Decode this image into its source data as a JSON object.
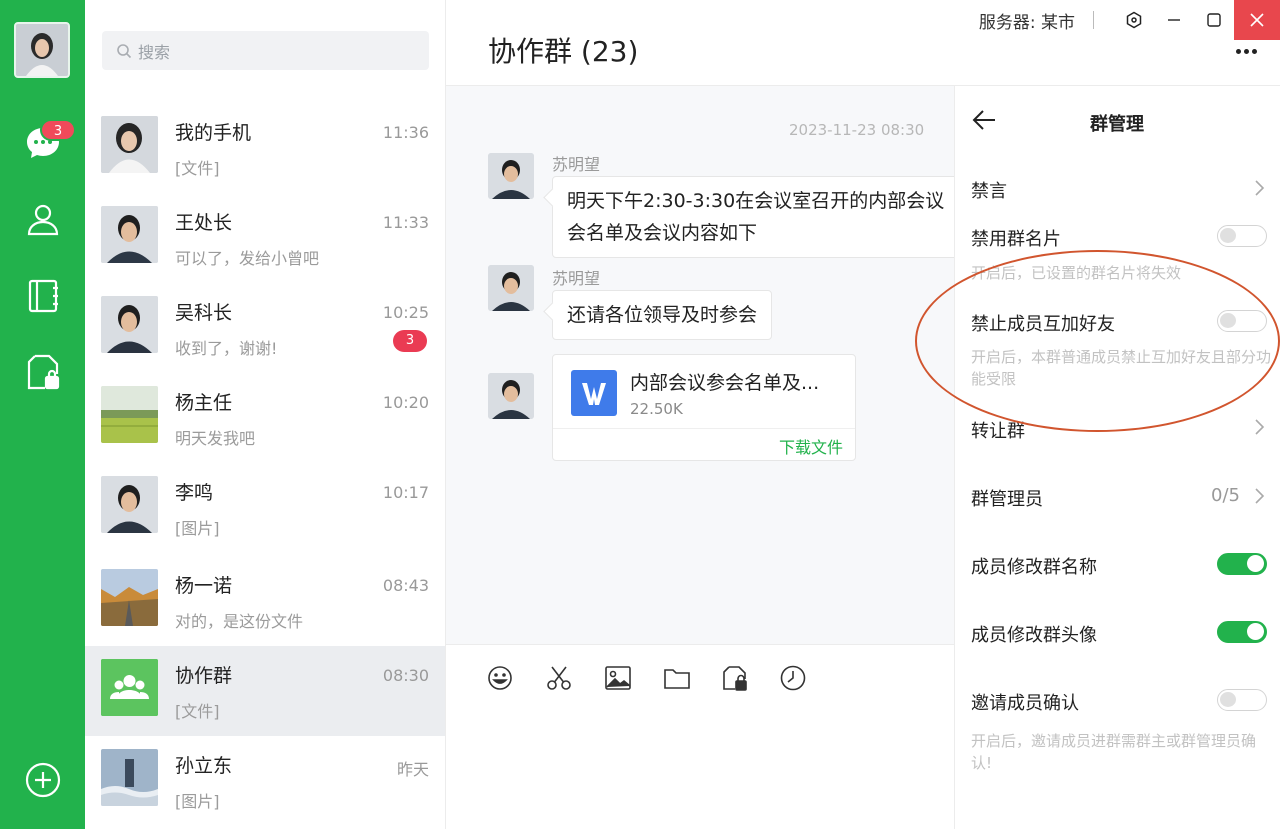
{
  "sidebar": {
    "unread_badge": "3",
    "icons": [
      "chat-icon",
      "contacts-icon",
      "notebook-icon",
      "secure-file-icon",
      "add-icon"
    ]
  },
  "search": {
    "placeholder": "搜索"
  },
  "contacts": [
    {
      "name": "我的手机",
      "time": "11:36",
      "preview": "[文件]",
      "badge": ""
    },
    {
      "name": "王处长",
      "time": "11:33",
      "preview": "可以了，发给小曾吧",
      "badge": ""
    },
    {
      "name": "吴科长",
      "time": "10:25",
      "preview": "收到了，谢谢!",
      "badge": "3"
    },
    {
      "name": "杨主任",
      "time": "10:20",
      "preview": "明天发我吧",
      "badge": ""
    },
    {
      "name": "李鸣",
      "time": "10:17",
      "preview": "[图片]",
      "badge": ""
    },
    {
      "name": "杨一诺",
      "time": "08:43",
      "preview": "对的，是这份文件",
      "badge": ""
    },
    {
      "name": "协作群",
      "time": "08:30",
      "preview": "[文件]",
      "badge": "",
      "active": true
    },
    {
      "name": "孙立东",
      "time": "昨天",
      "preview": "[图片]",
      "badge": ""
    }
  ],
  "chat": {
    "title": "协作群 (23)",
    "timestamp": "2023-11-23  08:30",
    "messages": [
      {
        "sender": "苏明望",
        "text_line1": "明天下午2:30-3:30在会议室召开的内部会议",
        "text_line2": "会名单及会议内容如下"
      },
      {
        "sender": "苏明望",
        "text_line1": "还请各位领导及时参会"
      }
    ],
    "file": {
      "name": "内部会议参会名单及...",
      "size": "22.50K",
      "action": "下载文件"
    }
  },
  "window": {
    "server_label": "服务器: 某市"
  },
  "management": {
    "title": "群管理",
    "rows": {
      "mute": "禁言",
      "disable_card": "禁用群名片",
      "disable_card_hint": "开启后，已设置的群名片将失效",
      "no_friend": "禁止成员互加好友",
      "no_friend_hint": "开启后，本群普通成员禁止互加好友且部分功能受限",
      "transfer": "转让群",
      "admins": "群管理员",
      "admins_value": "0/5",
      "edit_name": "成员修改群名称",
      "edit_avatar": "成员修改群头像",
      "invite_confirm": "邀请成员确认",
      "invite_confirm_hint": "开启后，邀请成员进群需群主或群管理员确认!"
    },
    "toggles": {
      "disable_card": false,
      "no_friend": false,
      "edit_name": true,
      "edit_avatar": true,
      "invite_confirm": false
    }
  },
  "colors": {
    "brand_green": "#22b24c",
    "badge_red": "#ea3b53",
    "annotation": "#d1552e"
  }
}
